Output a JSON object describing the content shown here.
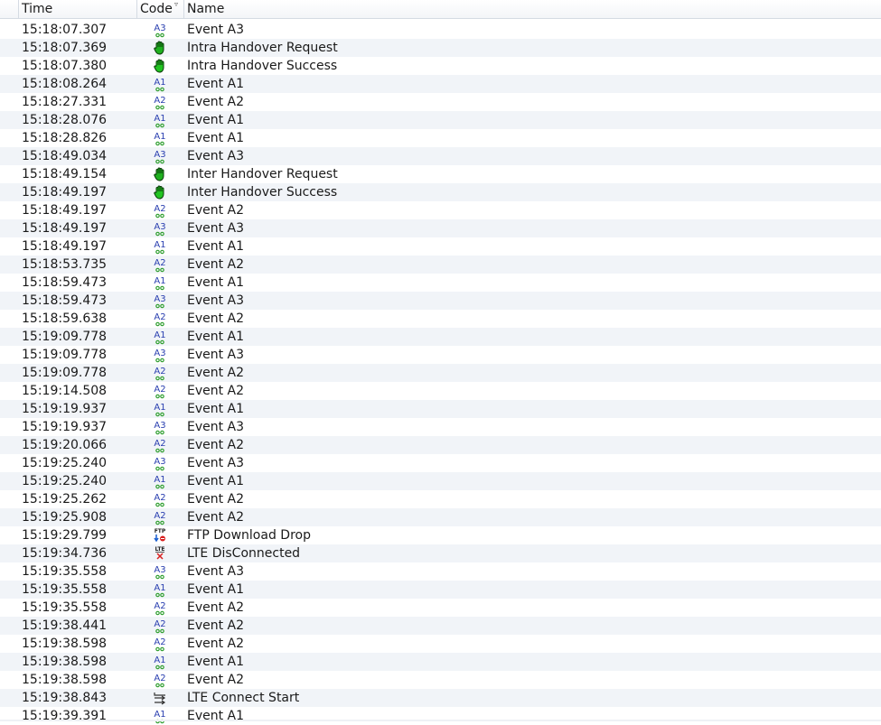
{
  "columns": {
    "time": "Time",
    "code": "Code",
    "name": "Name"
  },
  "events": [
    {
      "time": "15:18:07.307",
      "icon": "a3",
      "name": "Event A3"
    },
    {
      "time": "15:18:07.369",
      "icon": "hand-dark",
      "name": "Intra Handover Request"
    },
    {
      "time": "15:18:07.380",
      "icon": "hand",
      "name": "Intra Handover Success"
    },
    {
      "time": "15:18:08.264",
      "icon": "a1",
      "name": "Event A1"
    },
    {
      "time": "15:18:27.331",
      "icon": "a2",
      "name": "Event A2"
    },
    {
      "time": "15:18:28.076",
      "icon": "a1",
      "name": "Event A1"
    },
    {
      "time": "15:18:28.826",
      "icon": "a1",
      "name": "Event A1"
    },
    {
      "time": "15:18:49.034",
      "icon": "a3",
      "name": "Event A3"
    },
    {
      "time": "15:18:49.154",
      "icon": "hand-dark",
      "name": "Inter Handover Request"
    },
    {
      "time": "15:18:49.197",
      "icon": "hand",
      "name": "Inter Handover Success"
    },
    {
      "time": "15:18:49.197",
      "icon": "a2",
      "name": "Event A2"
    },
    {
      "time": "15:18:49.197",
      "icon": "a3",
      "name": "Event A3"
    },
    {
      "time": "15:18:49.197",
      "icon": "a1",
      "name": "Event A1"
    },
    {
      "time": "15:18:53.735",
      "icon": "a2",
      "name": "Event A2"
    },
    {
      "time": "15:18:59.473",
      "icon": "a1",
      "name": "Event A1"
    },
    {
      "time": "15:18:59.473",
      "icon": "a3",
      "name": "Event A3"
    },
    {
      "time": "15:18:59.638",
      "icon": "a2",
      "name": "Event A2"
    },
    {
      "time": "15:19:09.778",
      "icon": "a1",
      "name": "Event A1"
    },
    {
      "time": "15:19:09.778",
      "icon": "a3",
      "name": "Event A3"
    },
    {
      "time": "15:19:09.778",
      "icon": "a2",
      "name": "Event A2"
    },
    {
      "time": "15:19:14.508",
      "icon": "a2",
      "name": "Event A2"
    },
    {
      "time": "15:19:19.937",
      "icon": "a1",
      "name": "Event A1"
    },
    {
      "time": "15:19:19.937",
      "icon": "a3",
      "name": "Event A3"
    },
    {
      "time": "15:19:20.066",
      "icon": "a2",
      "name": "Event A2"
    },
    {
      "time": "15:19:25.240",
      "icon": "a3",
      "name": "Event A3"
    },
    {
      "time": "15:19:25.240",
      "icon": "a1",
      "name": "Event A1"
    },
    {
      "time": "15:19:25.262",
      "icon": "a2",
      "name": "Event A2"
    },
    {
      "time": "15:19:25.908",
      "icon": "a2",
      "name": "Event A2"
    },
    {
      "time": "15:19:29.799",
      "icon": "ftp",
      "name": "FTP Download Drop"
    },
    {
      "time": "15:19:34.736",
      "icon": "lte-x",
      "name": "LTE DisConnected"
    },
    {
      "time": "15:19:35.558",
      "icon": "a3",
      "name": "Event A3"
    },
    {
      "time": "15:19:35.558",
      "icon": "a1",
      "name": "Event A1"
    },
    {
      "time": "15:19:35.558",
      "icon": "a2",
      "name": "Event A2"
    },
    {
      "time": "15:19:38.441",
      "icon": "a2",
      "name": "Event A2"
    },
    {
      "time": "15:19:38.598",
      "icon": "a2",
      "name": "Event A2"
    },
    {
      "time": "15:19:38.598",
      "icon": "a1",
      "name": "Event A1"
    },
    {
      "time": "15:19:38.598",
      "icon": "a2",
      "name": "Event A2"
    },
    {
      "time": "15:19:38.843",
      "icon": "connect",
      "name": "LTE Connect Start"
    },
    {
      "time": "15:19:39.391",
      "icon": "a1",
      "name": "Event A1"
    }
  ],
  "icon_text": {
    "ftp": "FTP",
    "lte": "LTE"
  },
  "colors": {
    "event_blue": "#2a3fb0",
    "dot_green": "#2e9e2e",
    "hand_green": "#22c422",
    "ftp_red": "#d92020"
  }
}
